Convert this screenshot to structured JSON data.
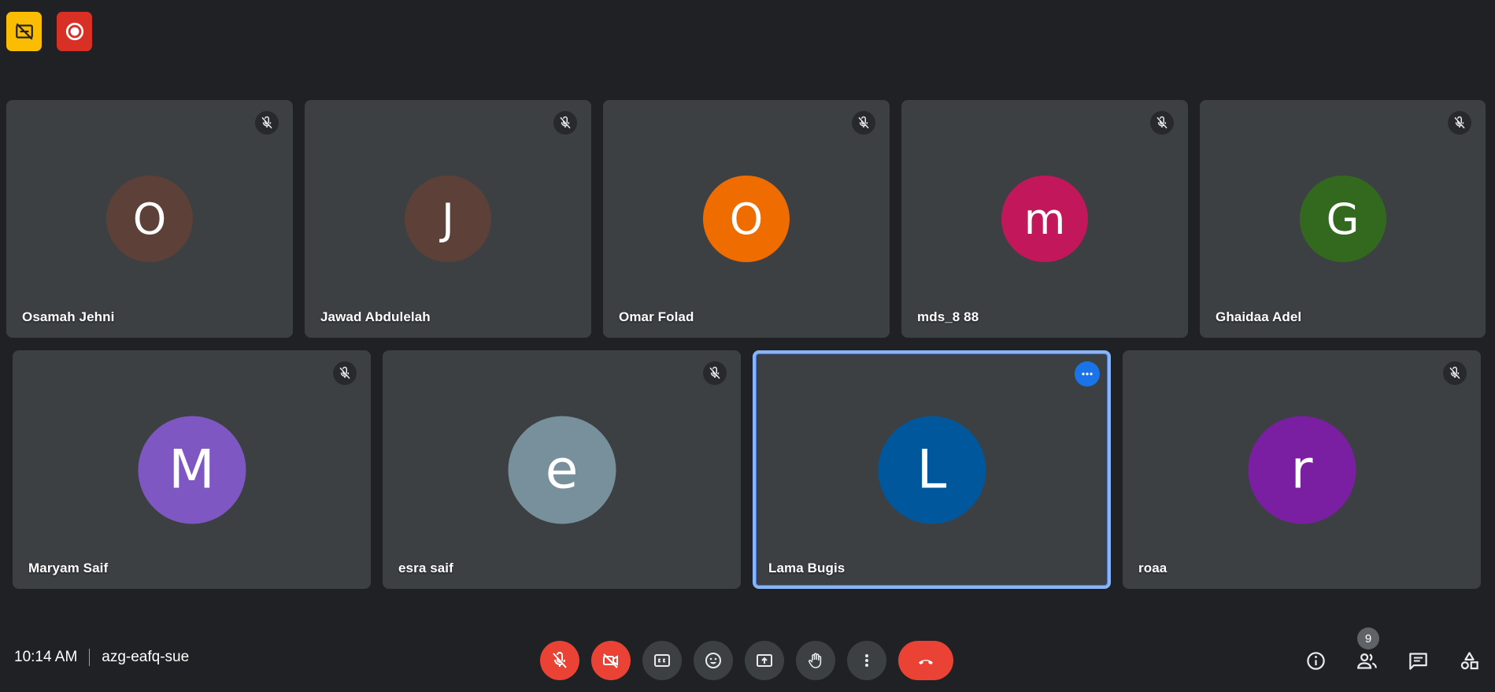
{
  "indicators": [
    {
      "icon": "no-captions-icon",
      "color": "#fbbc04"
    },
    {
      "icon": "recording-icon",
      "color": "#d93025"
    }
  ],
  "participants_row1": [
    {
      "name": "Osamah Jehni",
      "initial": "O",
      "color": "#5d4037",
      "muted": true
    },
    {
      "name": "Jawad Abdulelah",
      "initial": "J",
      "color": "#5d4037",
      "muted": true
    },
    {
      "name": "Omar Folad",
      "initial": "O",
      "color": "#ef6c00",
      "muted": true
    },
    {
      "name": "mds_8 88",
      "initial": "m",
      "color": "#c2185b",
      "muted": true
    },
    {
      "name": "Ghaidaa Adel",
      "initial": "G",
      "color": "#33691e",
      "muted": true
    }
  ],
  "participants_row2": [
    {
      "name": "Maryam Saif",
      "initial": "M",
      "color": "#7e57c2",
      "muted": true
    },
    {
      "name": "esra saif",
      "initial": "e",
      "color": "#78909c",
      "muted": true
    },
    {
      "name": "Lama Bugis",
      "initial": "L",
      "color": "#01579b",
      "muted": false,
      "active": true
    },
    {
      "name": "roaa",
      "initial": "r",
      "color": "#7b1fa2",
      "muted": true
    }
  ],
  "meeting": {
    "time": "10:14 AM",
    "code": "azg-eafq-sue"
  },
  "people_count": "9",
  "accent": {
    "active_border": "#8ab4f8",
    "danger": "#ea4335",
    "primary": "#1a73e8"
  }
}
